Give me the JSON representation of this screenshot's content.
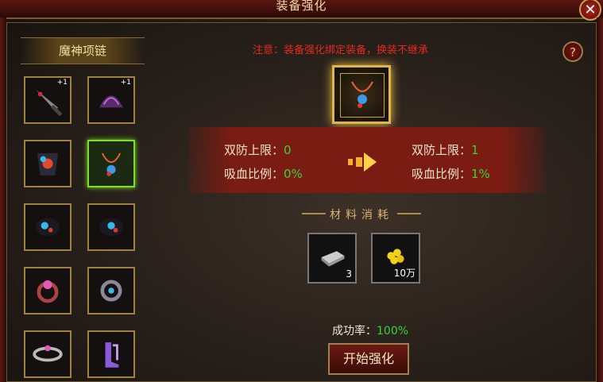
{
  "window": {
    "title": "装备强化",
    "close_label": "✕"
  },
  "left_panel": {
    "header": "魔神项链",
    "items": [
      {
        "name": "weapon",
        "badge": "+1",
        "selected": false
      },
      {
        "name": "helmet",
        "badge": "+1",
        "selected": false
      },
      {
        "name": "armor",
        "badge": "",
        "selected": false
      },
      {
        "name": "necklace",
        "badge": "",
        "selected": true
      },
      {
        "name": "bracelet-left",
        "badge": "",
        "selected": false
      },
      {
        "name": "bracelet-right",
        "badge": "",
        "selected": false
      },
      {
        "name": "ring-left",
        "badge": "",
        "selected": false
      },
      {
        "name": "ring-right",
        "badge": "",
        "selected": false
      },
      {
        "name": "belt",
        "badge": "",
        "selected": false
      },
      {
        "name": "boots",
        "badge": "",
        "selected": false
      }
    ]
  },
  "notice": "注意：装备强化绑定装备，换装不继承",
  "help_label": "?",
  "stats": {
    "before": [
      {
        "label": "双防上限：",
        "value": "0"
      },
      {
        "label": "吸血比例：",
        "value": "0%"
      }
    ],
    "after": [
      {
        "label": "双防上限：",
        "value": "1"
      },
      {
        "label": "吸血比例：",
        "value": "1%"
      }
    ]
  },
  "materials": {
    "title": "材料消耗",
    "items": [
      {
        "icon": "silver-ingot-icon",
        "count": "3"
      },
      {
        "icon": "gold-coins-icon",
        "count": "10万"
      }
    ]
  },
  "success": {
    "label": "成功率：",
    "value": "100%"
  },
  "start_button": "开始强化",
  "colors": {
    "highlight_green": "#39d13b",
    "warning_red": "#e22b1f",
    "gold_border": "#a0823e"
  }
}
